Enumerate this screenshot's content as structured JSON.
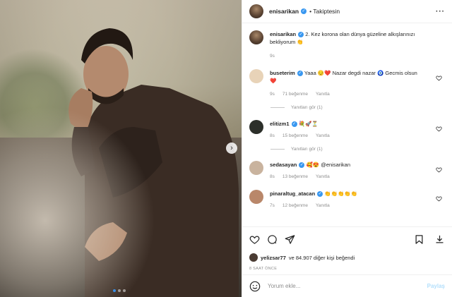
{
  "header": {
    "username": "enisarikan",
    "follow_label": "• Takiptesin",
    "more_label": "···"
  },
  "caption": {
    "username": "enisarikan",
    "text": "2. Kez korona olan dünya güzeline alkışlarınızı bekliyorum 👏",
    "time": "9s"
  },
  "comments": [
    {
      "username": "buseterim",
      "text": "Yaaa 😔❤️ Nazar degdi nazar 🧿 Gecmis olsun ❤️",
      "time": "9s",
      "likes": "71 beğenme",
      "reply_label": "Yanıtla",
      "view_replies": "Yanıtları gör (1)",
      "avatar_color": "#e8d3b8"
    },
    {
      "username": "elitizm1",
      "text": "💐🚀⏳",
      "time": "8s",
      "likes": "15 beğenme",
      "reply_label": "Yanıtla",
      "view_replies": "Yanıtları gör (1)",
      "avatar_color": "#2c2f2a"
    },
    {
      "username": "sedasayan",
      "text": "🥰😍 @enisarikan",
      "time": "8s",
      "likes": "13 beğenme",
      "reply_label": "Yanıtla",
      "avatar_color": "#c9b39e"
    },
    {
      "username": "pinaraltug_atacan",
      "text": "👏👏👏👏👏",
      "time": "7s",
      "likes": "12 beğenme",
      "reply_label": "Yanıtla",
      "avatar_color": "#b9876a"
    }
  ],
  "likes": {
    "user": "yelizsar77",
    "rest": "ve 84.907 diğer kişi beğendi"
  },
  "timestamp": "8 SAAT ÖNCE",
  "add_comment": {
    "placeholder": "Yorum ekle...",
    "post_label": "Paylaş"
  },
  "colors": {
    "verified": "#3897f0",
    "heart": "#ed4956",
    "muted": "#8e8e8e",
    "post_disabled": "#b2dffc"
  }
}
